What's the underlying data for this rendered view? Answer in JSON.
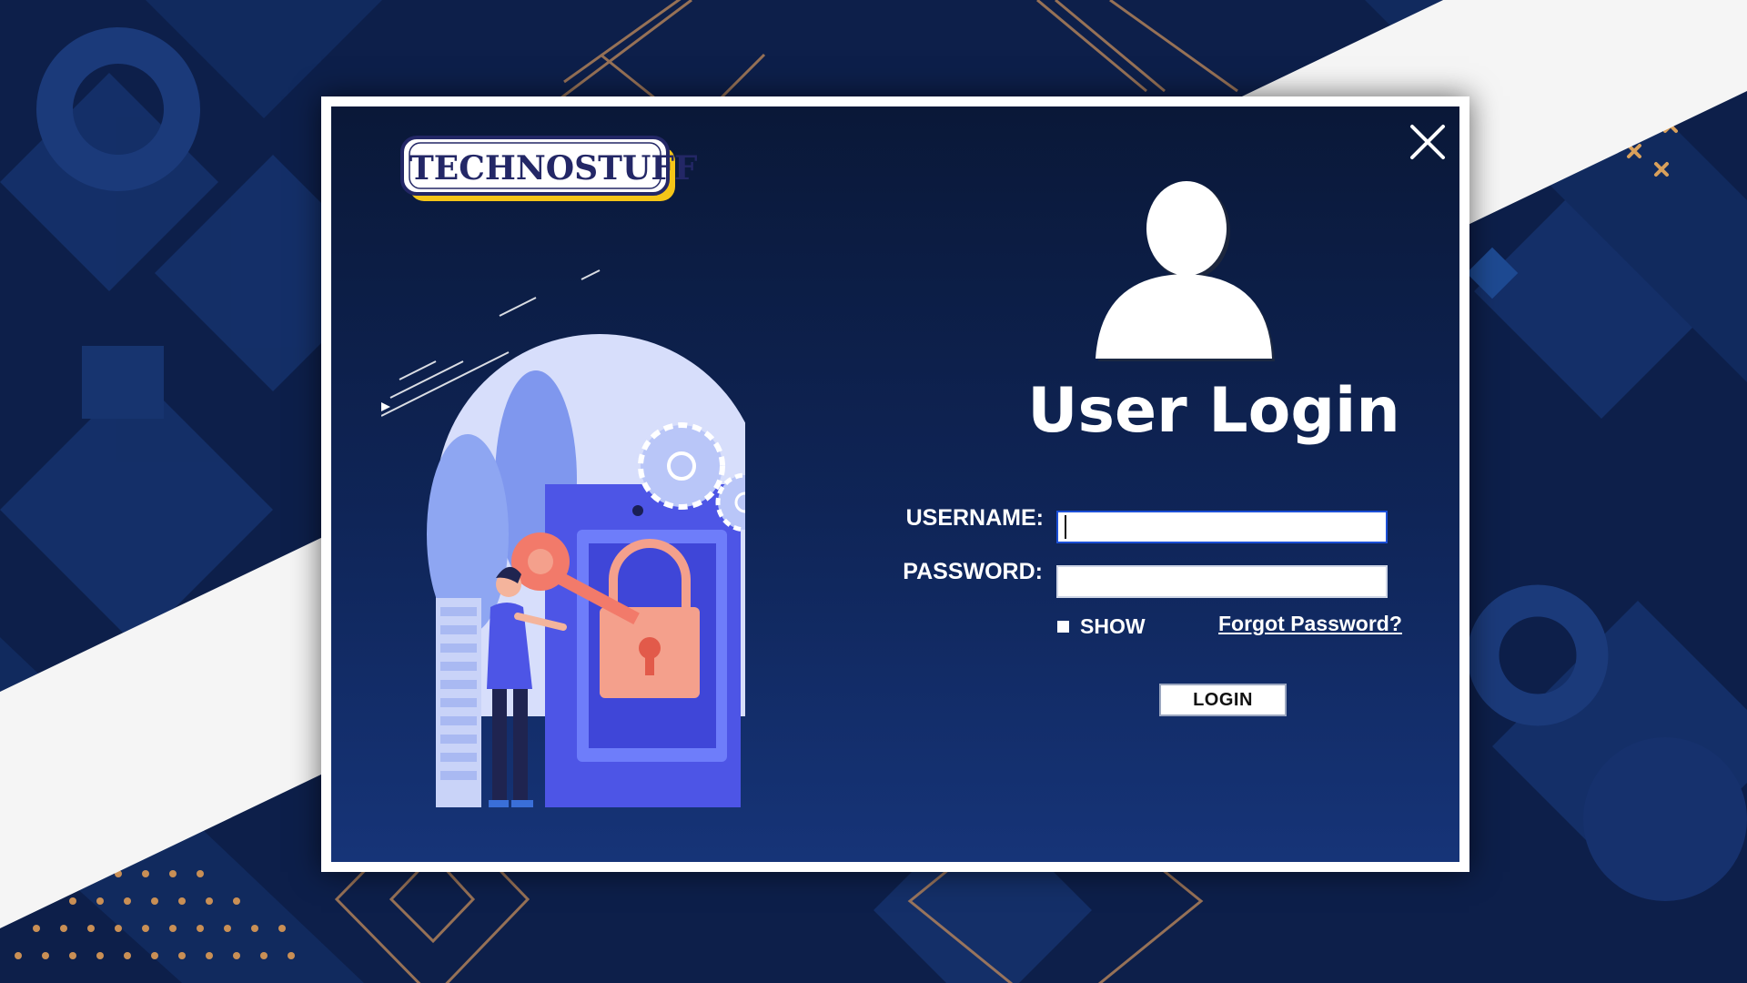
{
  "logo": {
    "text": "TECHNOSTUFF"
  },
  "login": {
    "title": "User Login",
    "username_label": "USERNAME:",
    "password_label": "PASSWORD:",
    "username_value": "",
    "password_value": "",
    "show_label": "SHOW",
    "show_checked": false,
    "forgot_label": "Forgot Password?",
    "login_button": "LOGIN"
  },
  "colors": {
    "background": "#0d1f4a",
    "dialog_top": "#0a1838",
    "dialog_bottom": "#163478",
    "accent_gold": "#d9a05b",
    "logo_yellow": "#f5c518",
    "logo_navy": "#232766"
  },
  "icons": {
    "close": "close-icon",
    "avatar": "user-avatar-icon",
    "illustration": "security-key-lock-illustration"
  }
}
